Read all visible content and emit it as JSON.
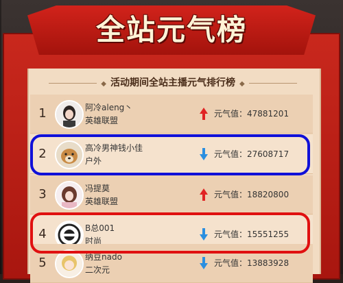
{
  "banner": {
    "title": "全站元气榜"
  },
  "subtitle": "活动期间全站主播元气排行榜",
  "rows": [
    {
      "rank": "1",
      "name": "阿冷aleng丶",
      "category": "英雄联盟",
      "trend": "up",
      "score": "元气值：47881201"
    },
    {
      "rank": "2",
      "name": "高冷男神钱小佳",
      "category": "户外",
      "trend": "down",
      "score": "元气值：27608717"
    },
    {
      "rank": "3",
      "name": "冯提莫",
      "category": "英雄联盟",
      "trend": "up",
      "score": "元气值：18820800"
    },
    {
      "rank": "4",
      "name": "B总001",
      "category": "时尚",
      "trend": "down",
      "score": "元气值：15551255"
    },
    {
      "rank": "5",
      "name": "纳豆nado",
      "category": "二次元",
      "trend": "down",
      "score": "元气值：13883928"
    }
  ],
  "colors": {
    "up": "#e02424",
    "down": "#2b8fe0",
    "blue_highlight": "#1010d8",
    "red_highlight": "#e01010"
  }
}
